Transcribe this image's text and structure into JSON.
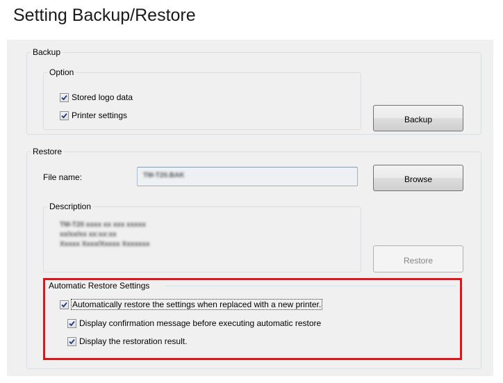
{
  "page_title": "Setting Backup/Restore",
  "backup": {
    "legend": "Backup",
    "option": {
      "legend": "Option",
      "items": [
        {
          "label": "Stored logo data",
          "checked": true
        },
        {
          "label": "Printer settings",
          "checked": true
        }
      ]
    },
    "backup_button": "Backup"
  },
  "restore": {
    "legend": "Restore",
    "file_name_label": "File name:",
    "file_name_value": "TM-T20.BAK",
    "browse_button": "Browse",
    "description": {
      "legend": "Description",
      "lines": [
        "TM-T20 xxxx xx xxx xxxxx",
        "xx/xx/xx xx:xx:xx",
        "Xxxxx Xxxx/Xxxxx Xxxxxxx"
      ]
    },
    "restore_button": "Restore"
  },
  "auto_restore": {
    "legend": "Automatic Restore Settings",
    "items": [
      {
        "label": "Automatically restore the settings when replaced with a new printer.",
        "checked": true
      },
      {
        "label": "Display confirmation message before executing automatic restore",
        "checked": true
      },
      {
        "label": "Display the restoration result.",
        "checked": true
      }
    ]
  },
  "colors": {
    "highlight_border": "#e1141c",
    "panel_bg": "#f0f0f0",
    "group_border": "#d5dfe5"
  }
}
